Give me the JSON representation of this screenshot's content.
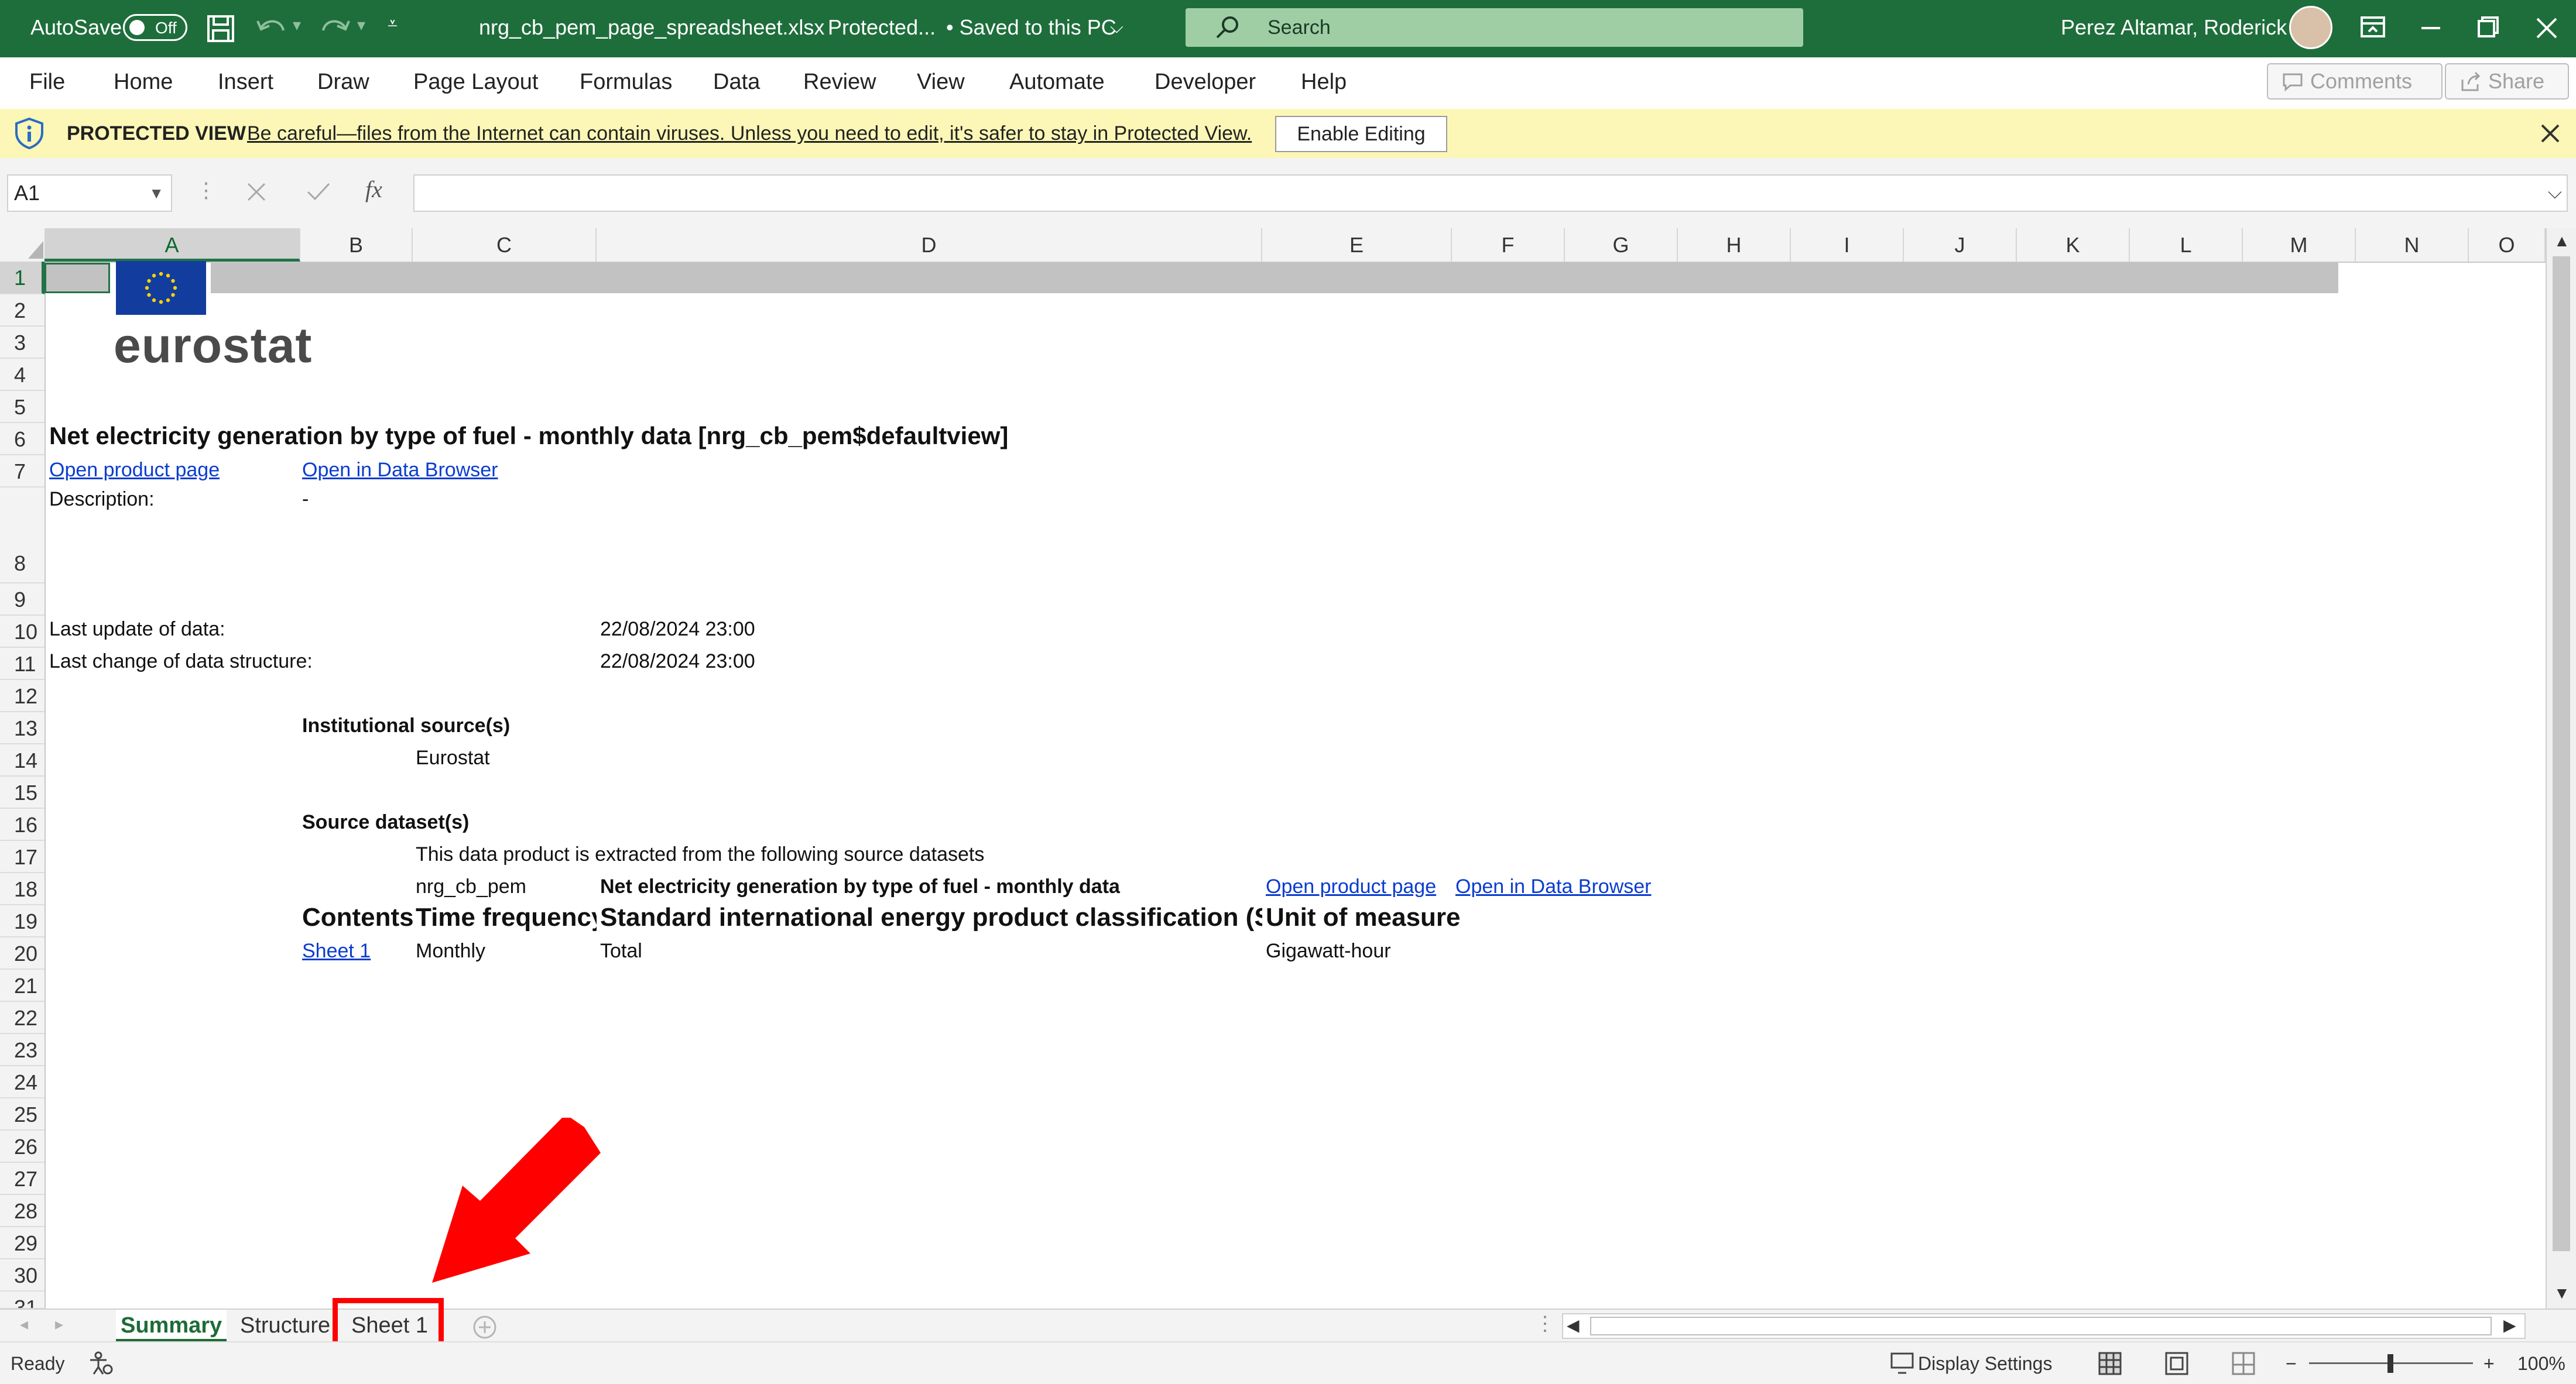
{
  "titlebar": {
    "autosave_label": "AutoSave",
    "autosave_state": "Off",
    "file_name": "nrg_cb_pem_page_spreadsheet.xlsx",
    "file_status": "Protected...",
    "save_status": "• Saved to this PC",
    "search_placeholder": "Search",
    "user_name": "Perez Altamar, Roderick",
    "accent_color": "#1e6e3c"
  },
  "ribbon": {
    "tabs": [
      "File",
      "Home",
      "Insert",
      "Draw",
      "Page Layout",
      "Formulas",
      "Data",
      "Review",
      "View",
      "Automate",
      "Developer",
      "Help"
    ],
    "comments_label": "Comments",
    "share_label": "Share"
  },
  "protected_view": {
    "title": "PROTECTED VIEW",
    "message": "Be careful—files from the Internet can contain viruses. Unless you need to edit, it's safer to stay in Protected View.",
    "enable_button": "Enable Editing"
  },
  "formula_bar": {
    "name_box": "A1",
    "fx_label": "fx",
    "value": ""
  },
  "grid": {
    "columns": [
      "A",
      "B",
      "C",
      "D",
      "E",
      "F",
      "G",
      "H",
      "I",
      "J",
      "K",
      "L",
      "M",
      "N",
      "O"
    ],
    "selected_column": "A",
    "rows": [
      "1",
      "2",
      "3",
      "4",
      "5",
      "6",
      "7",
      "8",
      "9",
      "10",
      "11",
      "12",
      "13",
      "14",
      "15",
      "16",
      "17",
      "18",
      "19",
      "20",
      "21",
      "22",
      "23",
      "24",
      "25",
      "26",
      "27",
      "28",
      "29",
      "30",
      "31"
    ],
    "selected_row": "1"
  },
  "sheet": {
    "logo_text": "eurostat",
    "title": "Net electricity generation by type of fuel - monthly data [nrg_cb_pem$defaultview]",
    "link_product": "Open product page",
    "link_browser": "Open in Data Browser",
    "description_label": "Description:",
    "description_value": "-",
    "last_update_label": "Last update of data:",
    "last_update_value": "22/08/2024 23:00",
    "last_change_label": "Last change of data structure:",
    "last_change_value": "22/08/2024 23:00",
    "inst_source_heading": "Institutional source(s)",
    "inst_source_value": "Eurostat",
    "source_dataset_heading": "Source dataset(s)",
    "source_dataset_intro": "This data product is extracted from the following source datasets",
    "dataset_code": "nrg_cb_pem",
    "dataset_name": "Net electricity generation by type of fuel - monthly data",
    "dataset_link_product": "Open product page",
    "dataset_link_browser": "Open in Data Browser",
    "table_headers": [
      "Contents",
      "Time frequency",
      "Standard international energy product classification (SIEC)",
      "Unit of measure"
    ],
    "table_row": [
      "Sheet 1",
      "Monthly",
      "Total",
      "Gigawatt-hour"
    ]
  },
  "sheet_tabs": {
    "tabs": [
      "Summary",
      "Structure",
      "Sheet 1"
    ],
    "active": "Summary",
    "highlighted": "Sheet 1"
  },
  "status_bar": {
    "state": "Ready",
    "display_settings": "Display Settings",
    "zoom": "100%"
  }
}
